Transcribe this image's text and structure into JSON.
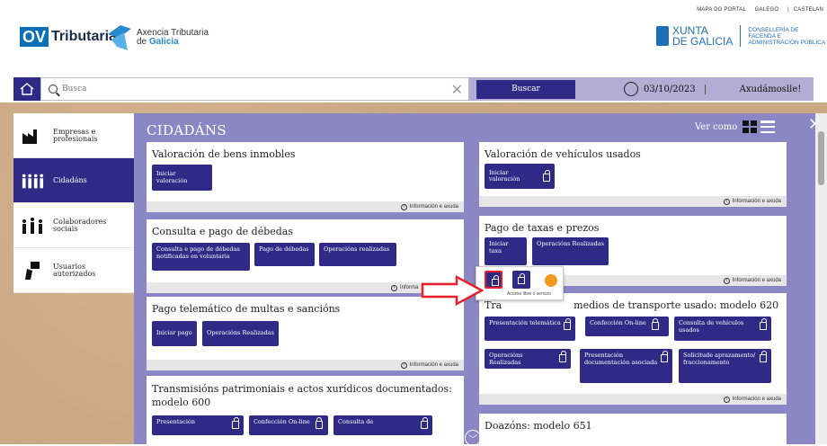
{
  "header": {
    "links": [
      "MAPA DO PORTAL",
      "GALEGO",
      "|",
      "CASTELAN"
    ],
    "ov_mark": "OV",
    "ov_name": "Tributaria",
    "agency_line1": "Axencia Tributaria",
    "agency_line2_prefix": "de ",
    "agency_line2_bold": "Galicia",
    "xunta_line1": "XUNTA",
    "xunta_line2": "DE GALICIA",
    "conselleria_line1": "CONSELLERÍA DE",
    "conselleria_line2": "FACENDA E",
    "conselleria_line3": "ADMINISTRACIÓN PÚBLICA"
  },
  "search": {
    "placeholder": "Busca",
    "button": "Buscar",
    "date": "03/10/2023",
    "greeting": "Axudámoslle!"
  },
  "sidebar": {
    "items": [
      {
        "line1": "Empresas e",
        "line2": "profesionais",
        "icon": "factory-icon",
        "active": false
      },
      {
        "line1": "Cidadáns",
        "line2": "",
        "icon": "people-icon",
        "active": true
      },
      {
        "line1": "Colaboradores",
        "line2": "sociais",
        "icon": "collaborators-icon",
        "active": false
      },
      {
        "line1": "Usuarios",
        "line2": "autorizados",
        "icon": "authorized-users-icon",
        "active": false
      }
    ]
  },
  "main": {
    "title": "CIDADÁNS",
    "view_as": "Ver como",
    "info_help": "Información e axuda",
    "info_truncated": "Informa",
    "cards": {
      "bens": {
        "title": "Valoración de bens inmobles",
        "buttons": [
          "Iniciar valoración"
        ]
      },
      "vehiculos": {
        "title": "Valoración de vehículos usados",
        "buttons": [
          "Iniciar valoración"
        ]
      },
      "debedas": {
        "title": "Consulta e pago de débedas",
        "buttons": [
          "Consulta e pago de débedas notificadas en voluntaria",
          "Pago de débedas",
          "Operacións realizadas"
        ]
      },
      "taxas": {
        "title": "Pago de taxas e prezos",
        "buttons": [
          "Iniciar taxa",
          "Operacións Realizadas"
        ]
      },
      "multas": {
        "title": "Pago telemático de multas e sancións",
        "buttons": [
          "Iniciar pago",
          "Operacións Realizadas"
        ]
      },
      "transporte": {
        "title_prefix": "Tra",
        "title_suffix": "medios de transporte usado: modelo 620",
        "buttons": [
          "Presentación telemática",
          "Confección On-line",
          "Consulta de vehículos usados",
          "Operacións Realizadas",
          "Presentación documentación asociada",
          "Solicitude aprazamento/ fraccionamento"
        ]
      },
      "transmisions": {
        "title": "Transmisións patrimoniais e actos xurídicos documentados: modelo 600",
        "buttons": [
          "Presentación",
          "Confección On-line",
          "Consulta de"
        ]
      },
      "doazons": {
        "title": "Doazóns: modelo 651"
      }
    },
    "popup_tooltip": "Acceso libre ó servizo"
  },
  "colors": {
    "primary": "#2e2a86",
    "panel": "#8b86c4",
    "accent_red": "#e8202a"
  }
}
